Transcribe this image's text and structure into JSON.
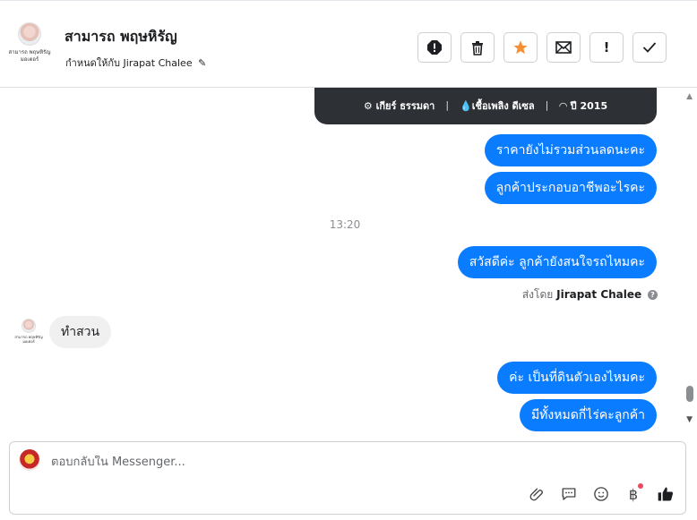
{
  "header": {
    "avatar_caption_line1": "สามารถ พฤษหิรัญ",
    "avatar_caption_line2": "มอเตอร์",
    "title": "สามารถ พฤษหิรัญ",
    "assigned_label": "กำหนดให้กับ Jirapat Chalee",
    "buttons": [
      "alert-icon",
      "trash-icon",
      "star-icon",
      "mail-icon",
      "exclamation-icon",
      "check-icon"
    ],
    "star_color": "#f68e33"
  },
  "car_card": {
    "gear": "เกียร์ ธรรมดา",
    "fuel": "เชื้อเพลิง ดีเซล",
    "year": "ปี 2015",
    "separator": "|"
  },
  "messages": {
    "out1": "ราคายังไม่รวมส่วนลดนะคะ",
    "out2": "ลูกค้าประกอบอาชีพอะไรคะ",
    "time": "13:20",
    "out3": "สวัสดีค่ะ ลูกค้ายังสนใจรถไหมคะ",
    "sent_by_label": "ส่งโดย",
    "sent_by_name": "Jirapat Chalee",
    "in1": "ทำสวน",
    "out4": "ค่ะ เป็นที่ดินตัวเองไหมคะ",
    "out5": "มีทั้งหมดกี่ไร่คะลูกค้า"
  },
  "composer": {
    "placeholder": "ตอบกลับใน Messenger...",
    "tools": [
      "attachment-icon",
      "saved-replies-icon",
      "emoji-icon",
      "payment-icon",
      "like-icon"
    ],
    "payment_symbol": "฿"
  },
  "colors": {
    "outgoing_bubble": "#0a7cff",
    "incoming_bubble": "#f0f0f0",
    "card_bg": "#2d3034"
  }
}
